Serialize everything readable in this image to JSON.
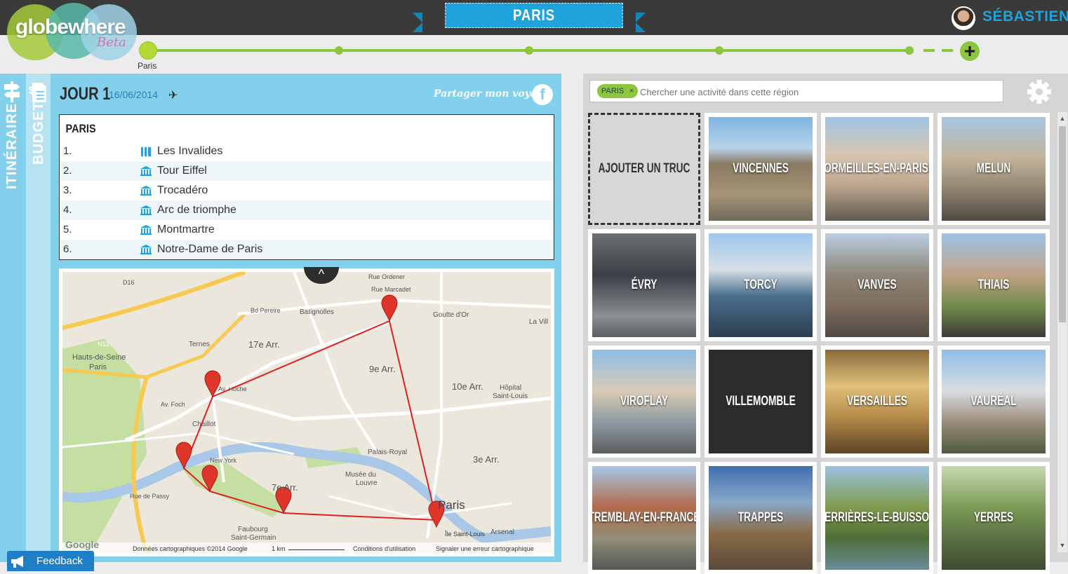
{
  "header": {
    "city_banner": "PARIS",
    "username": "SÉBASTIEN"
  },
  "logo": {
    "text": "globewhere",
    "tag": "Beta"
  },
  "timeline": {
    "first_stop": "Paris",
    "add_label": "+"
  },
  "tabs": {
    "itinerary": "ITINÉRAIRE",
    "budget": "BUDGET"
  },
  "day": {
    "title": "JOUR 1",
    "date": "16/06/2014",
    "share_label": "Partager mon voyage",
    "facebook": "f",
    "city": "PARIS",
    "stops": [
      {
        "num": "1.",
        "name": "Les Invalides"
      },
      {
        "num": "2.",
        "name": "Tour Eiffel"
      },
      {
        "num": "3.",
        "name": "Trocadéro"
      },
      {
        "num": "4.",
        "name": "Arc de triomphe"
      },
      {
        "num": "5.",
        "name": "Montmartre"
      },
      {
        "num": "6.",
        "name": "Notre-Dame de Paris"
      }
    ]
  },
  "map": {
    "labels": {
      "l17": "17e Arr.",
      "l9": "9e Arr.",
      "l10": "10e Arr.",
      "l3": "3e Arr.",
      "l7": "7e Arr.",
      "paris": "Paris",
      "hauts": "Hauts-de-Seine",
      "hauts2": "Paris",
      "ternes": "Ternes",
      "batignolles": "Batignolles",
      "chaillot": "Chaillot",
      "louvre1": "Musée du",
      "louvre2": "Louvre",
      "palais": "Palais-Royal",
      "faubourg1": "Faubourg",
      "faubourg2": "Saint-Germain",
      "hopital1": "Hôpital",
      "hopital2": "Saint-Louis",
      "goutte": "Goutte d'Or",
      "ile": "Île Saint-Louis",
      "arsenal": "Arsenal",
      "lavilla": "La Vill",
      "d16": "D16",
      "n13": "N13",
      "bdpereire": "Bd Pereire",
      "avfoch": "Av. Foch",
      "avhoche": "Av. Hoche",
      "ruepassy": "Rue de Passy",
      "newyork": "New York",
      "ruemarcadet": "Rue Marcadet",
      "rueordener": "Rue Ordener"
    },
    "footer": {
      "google": "Google",
      "data": "Données cartographiques ©2014 Google",
      "scale": "1 km",
      "terms": "Conditions d'utilisation",
      "report": "Signaler une erreur cartographique"
    },
    "collapse": "^"
  },
  "activities": {
    "tag": "PARIS",
    "tag_remove": "×",
    "search_placeholder": "Chercher une activité dans cette région",
    "tiles": [
      {
        "label": "AJOUTER UN TRUC"
      },
      {
        "label": "VINCENNES"
      },
      {
        "label": "CORMEILLES-EN-PARISIS"
      },
      {
        "label": "MELUN"
      },
      {
        "label": "ÉVRY"
      },
      {
        "label": "TORCY"
      },
      {
        "label": "VANVES"
      },
      {
        "label": "THIAIS"
      },
      {
        "label": "VIROFLAY"
      },
      {
        "label": "VILLEMOMBLE"
      },
      {
        "label": "VERSAILLES"
      },
      {
        "label": "VAURÉAL"
      },
      {
        "label": "TREMBLAY-EN-FRANCE"
      },
      {
        "label": "TRAPPES"
      },
      {
        "label": "VERRIÈRES-LE-BUISSON"
      },
      {
        "label": "YERRES"
      }
    ]
  },
  "feedback": {
    "label": "Feedback"
  },
  "colors": {
    "accent_blue": "#1ea3dc",
    "panel_blue": "#82d0ec",
    "green": "#8cc63f",
    "route_red": "#e02020"
  }
}
